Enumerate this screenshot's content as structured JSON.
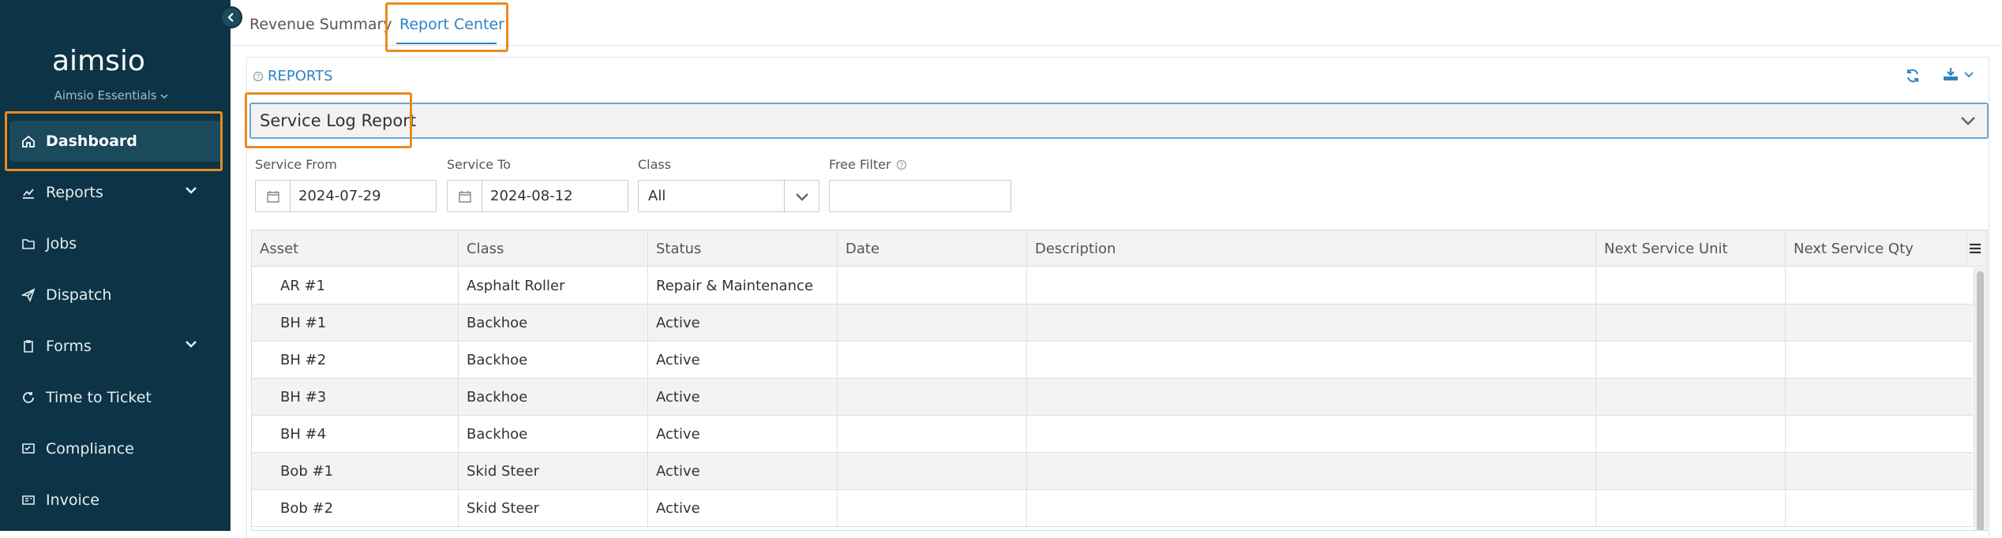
{
  "app": {
    "logo_text": "aimsio",
    "workspace": "Aimsio Essentials"
  },
  "sidebar": {
    "items": [
      {
        "label": "Dashboard",
        "icon": "home-icon",
        "active": true,
        "expandable": false
      },
      {
        "label": "Reports",
        "icon": "chart-icon",
        "active": false,
        "expandable": true
      },
      {
        "label": "Jobs",
        "icon": "folder-icon",
        "active": false,
        "expandable": false
      },
      {
        "label": "Dispatch",
        "icon": "paper-plane-icon",
        "active": false,
        "expandable": false
      },
      {
        "label": "Forms",
        "icon": "clipboard-icon",
        "active": false,
        "expandable": true
      },
      {
        "label": "Time to Ticket",
        "icon": "history-icon",
        "active": false,
        "expandable": false
      },
      {
        "label": "Compliance",
        "icon": "checklist-icon",
        "active": false,
        "expandable": false
      },
      {
        "label": "Invoice",
        "icon": "invoice-icon",
        "active": false,
        "expandable": false
      }
    ]
  },
  "tabs": [
    {
      "label": "Revenue Summary",
      "active": false
    },
    {
      "label": "Report Center",
      "active": true
    }
  ],
  "reports": {
    "label": "REPORTS",
    "selected_report": "Service Log Report"
  },
  "filters": {
    "service_from": {
      "label": "Service From",
      "value": "2024-07-29"
    },
    "service_to": {
      "label": "Service To",
      "value": "2024-08-12"
    },
    "class": {
      "label": "Class",
      "value": "All"
    },
    "free_filter": {
      "label": "Free Filter",
      "value": ""
    }
  },
  "table": {
    "columns": [
      "Asset",
      "Class",
      "Status",
      "Date",
      "Description",
      "Next Service Unit",
      "Next Service Qty"
    ],
    "rows": [
      [
        "AR #1",
        "Asphalt Roller",
        "Repair & Maintenance",
        "",
        "",
        "",
        ""
      ],
      [
        "BH #1",
        "Backhoe",
        "Active",
        "",
        "",
        "",
        ""
      ],
      [
        "BH #2",
        "Backhoe",
        "Active",
        "",
        "",
        "",
        ""
      ],
      [
        "BH #3",
        "Backhoe",
        "Active",
        "",
        "",
        "",
        ""
      ],
      [
        "BH #4",
        "Backhoe",
        "Active",
        "",
        "",
        "",
        ""
      ],
      [
        "Bob #1",
        "Skid Steer",
        "Active",
        "",
        "",
        "",
        ""
      ],
      [
        "Bob #2",
        "Skid Steer",
        "Active",
        "",
        "",
        "",
        ""
      ]
    ]
  },
  "colors": {
    "sidebar_bg": "#0d3446",
    "sidebar_active": "#1b4a5d",
    "accent": "#2f82c2",
    "highlight": "#ec8a1f"
  }
}
